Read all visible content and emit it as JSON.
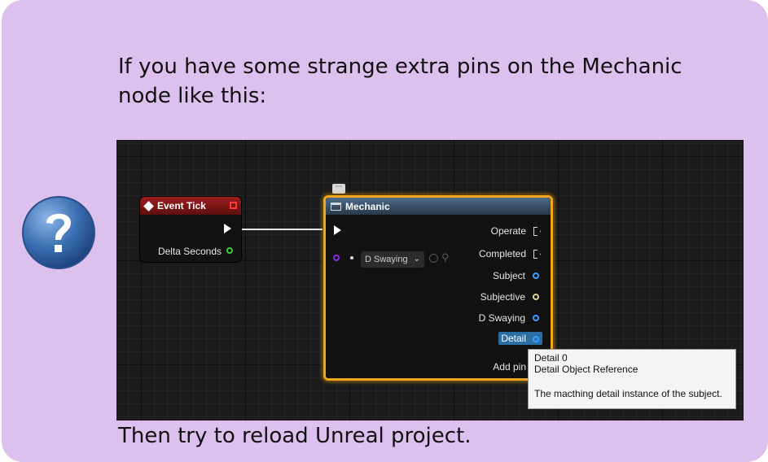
{
  "intro_text": "If you have some strange extra pins on the Mechanic node like this:",
  "outro_text": "Then try to reload Unreal project.",
  "question_icon": "question-mark-icon",
  "blueprint": {
    "event_node": {
      "title": "Event Tick",
      "pins": [
        "Delta Seconds"
      ]
    },
    "mechanic_node": {
      "title": "Mechanic",
      "comment_bubble": "···",
      "dropdown_value": "D Swaying",
      "outputs": [
        "Operate",
        "Completed",
        "Subject",
        "Subjective",
        "D Swaying",
        "Detail"
      ],
      "add_pin": "Add pin"
    },
    "tooltip": {
      "line1": "Detail 0",
      "line2": "Detail Object Reference",
      "line3": "The macthing detail instance of the subject."
    }
  },
  "colors": {
    "panel": "#dcc0ee",
    "event_header": "#9c1d1d",
    "mechanic_border": "#f0a818",
    "pin_green": "#3ecc3e",
    "pin_blue": "#3aa0ff",
    "pin_yellow": "#d8d890",
    "pin_purple": "#8a2be2"
  }
}
